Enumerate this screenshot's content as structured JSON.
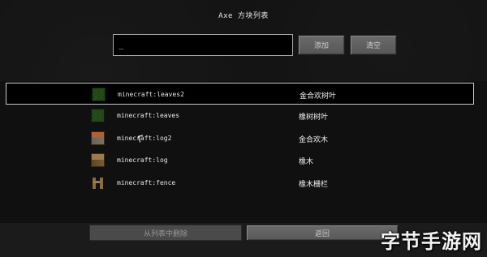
{
  "screen": {
    "title": "Axe 方块列表"
  },
  "search": {
    "value": "_",
    "placeholder": ""
  },
  "buttons": {
    "add": "添加",
    "clear": "清空",
    "remove": "从列表中删除",
    "back": "返回"
  },
  "list": {
    "items": [
      {
        "id": "minecraft:leaves2",
        "name": "金合欢树叶",
        "icon": "acacia-leaves-icon",
        "selected": true
      },
      {
        "id": "minecraft:leaves",
        "name": "橡树树叶",
        "icon": "oak-leaves-icon",
        "selected": false
      },
      {
        "id": "minecraft:log2",
        "name": "金合欢木",
        "icon": "acacia-log-icon",
        "selected": false
      },
      {
        "id": "minecraft:log",
        "name": "橡木",
        "icon": "oak-log-icon",
        "selected": false
      },
      {
        "id": "minecraft:fence",
        "name": "橡木栅栏",
        "icon": "oak-fence-icon",
        "selected": false
      }
    ]
  },
  "watermark": {
    "text": "字节手游网"
  },
  "colors": {
    "background": "#171717",
    "selection_border": "#c8c8c8",
    "button": "#6b6b6b",
    "button_disabled": "#4a4a4a"
  }
}
